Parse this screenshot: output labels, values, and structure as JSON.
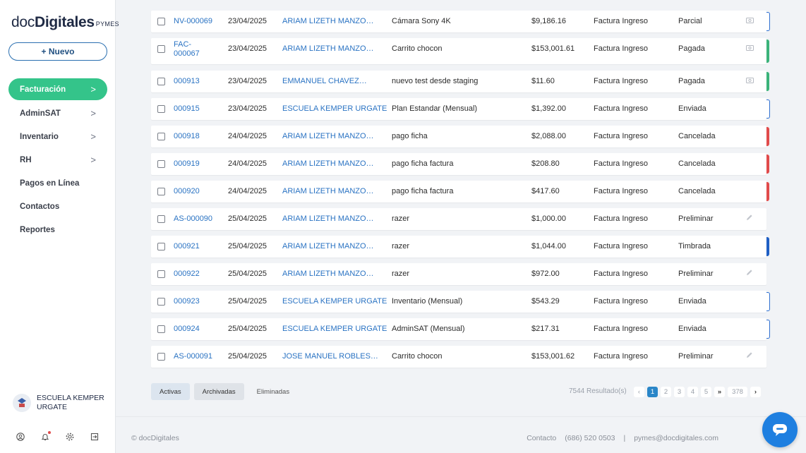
{
  "brand": {
    "doc": "doc",
    "digitales": "Digitales",
    "pymes": "PYMES"
  },
  "sidebar": {
    "new_label": "+ Nuevo",
    "items": [
      {
        "label": "Facturación",
        "arrow": ">"
      },
      {
        "label": "AdminSAT",
        "arrow": ">"
      },
      {
        "label": "Inventario",
        "arrow": ">"
      },
      {
        "label": "RH",
        "arrow": ">"
      },
      {
        "label": "Pagos en Línea",
        "arrow": ""
      },
      {
        "label": "Contactos",
        "arrow": ""
      },
      {
        "label": "Reportes",
        "arrow": ""
      }
    ],
    "org_name": "ESCUELA KEMPER URGATE",
    "icons": [
      "user-circle-icon",
      "bell-icon",
      "gear-icon",
      "logout-icon"
    ]
  },
  "rows": [
    {
      "folio": "NV-000069",
      "date": "23/04/2025",
      "client": "ARIAM LIZETH MANZO…",
      "concept": "Cámara Sony 4K",
      "amount": "$9,186.16",
      "type": "Factura Ingreso",
      "status": "Parcial",
      "icon": "money-icon",
      "bar_color": "#2e6fd0",
      "bar_style": "outline"
    },
    {
      "folio": "FAC-000067",
      "date": "23/04/2025",
      "client": "ARIAM LIZETH MANZO…",
      "concept": "Carrito chocon",
      "amount": "$153,001.61",
      "type": "Factura Ingreso",
      "status": "Pagada",
      "icon": "money-icon",
      "bar_color": "#3bb37a",
      "bar_style": "solid"
    },
    {
      "folio": "000913",
      "date": "23/04/2025",
      "client": "EMMANUEL CHAVEZ…",
      "concept": "nuevo test desde staging",
      "amount": "$11.60",
      "type": "Factura Ingreso",
      "status": "Pagada",
      "icon": "money-icon",
      "bar_color": "#3bb37a",
      "bar_style": "solid"
    },
    {
      "folio": "000915",
      "date": "23/04/2025",
      "client": "ESCUELA KEMPER URGATE",
      "concept": "Plan Estandar (Mensual)",
      "amount": "$1,392.00",
      "type": "Factura Ingreso",
      "status": "Enviada",
      "icon": "",
      "bar_color": "#2e6fd0",
      "bar_style": "outline"
    },
    {
      "folio": "000918",
      "date": "24/04/2025",
      "client": "ARIAM LIZETH MANZO…",
      "concept": "pago ficha",
      "amount": "$2,088.00",
      "type": "Factura Ingreso",
      "status": "Cancelada",
      "icon": "",
      "bar_color": "#e14b4b",
      "bar_style": "solid"
    },
    {
      "folio": "000919",
      "date": "24/04/2025",
      "client": "ARIAM LIZETH MANZO…",
      "concept": "pago ficha factura",
      "amount": "$208.80",
      "type": "Factura Ingreso",
      "status": "Cancelada",
      "icon": "",
      "bar_color": "#e14b4b",
      "bar_style": "solid"
    },
    {
      "folio": "000920",
      "date": "24/04/2025",
      "client": "ARIAM LIZETH MANZO…",
      "concept": "pago ficha factura",
      "amount": "$417.60",
      "type": "Factura Ingreso",
      "status": "Cancelada",
      "icon": "",
      "bar_color": "#e14b4b",
      "bar_style": "solid"
    },
    {
      "folio": "AS-000090",
      "date": "25/04/2025",
      "client": "ARIAM LIZETH MANZO…",
      "concept": "razer",
      "amount": "$1,000.00",
      "type": "Factura Ingreso",
      "status": "Preliminar",
      "icon": "pencil-icon",
      "bar_color": "",
      "bar_style": "none"
    },
    {
      "folio": "000921",
      "date": "25/04/2025",
      "client": "ARIAM LIZETH MANZO…",
      "concept": "razer",
      "amount": "$1,044.00",
      "type": "Factura Ingreso",
      "status": "Timbrada",
      "icon": "",
      "bar_color": "#1f5fc4",
      "bar_style": "solid"
    },
    {
      "folio": "000922",
      "date": "25/04/2025",
      "client": "ARIAM LIZETH MANZO…",
      "concept": "razer",
      "amount": "$972.00",
      "type": "Factura Ingreso",
      "status": "Preliminar",
      "icon": "pencil-icon",
      "bar_color": "",
      "bar_style": "none"
    },
    {
      "folio": "000923",
      "date": "25/04/2025",
      "client": "ESCUELA KEMPER URGATE",
      "concept": "Inventario (Mensual)",
      "amount": "$543.29",
      "type": "Factura Ingreso",
      "status": "Enviada",
      "icon": "",
      "bar_color": "#2e6fd0",
      "bar_style": "outline"
    },
    {
      "folio": "000924",
      "date": "25/04/2025",
      "client": "ESCUELA KEMPER URGATE",
      "concept": "AdminSAT (Mensual)",
      "amount": "$217.31",
      "type": "Factura Ingreso",
      "status": "Enviada",
      "icon": "",
      "bar_color": "#2e6fd0",
      "bar_style": "outline"
    },
    {
      "folio": "AS-000091",
      "date": "25/04/2025",
      "client": "JOSE MANUEL ROBLES…",
      "concept": "Carrito chocon",
      "amount": "$153,001.62",
      "type": "Factura Ingreso",
      "status": "Preliminar",
      "icon": "pencil-icon",
      "bar_color": "",
      "bar_style": "none"
    }
  ],
  "tabs": {
    "active": "Activas",
    "archived": "Archivadas",
    "deleted": "Eliminadas"
  },
  "pagination": {
    "results": "7544 Resultado(s)",
    "prev": "‹",
    "pages": [
      "1",
      "2",
      "3",
      "4",
      "5"
    ],
    "jump": "»",
    "last": "378",
    "next": "›",
    "current": "1"
  },
  "footer": {
    "copyright": "© docDigitales",
    "contact": "Contacto",
    "phone": "(686) 520 0503",
    "sep": "|",
    "email": "pymes@docdigitales.com"
  },
  "colors": {
    "accent": "#34c48a",
    "link": "#2a73c3",
    "chat": "#1e7fe0"
  }
}
